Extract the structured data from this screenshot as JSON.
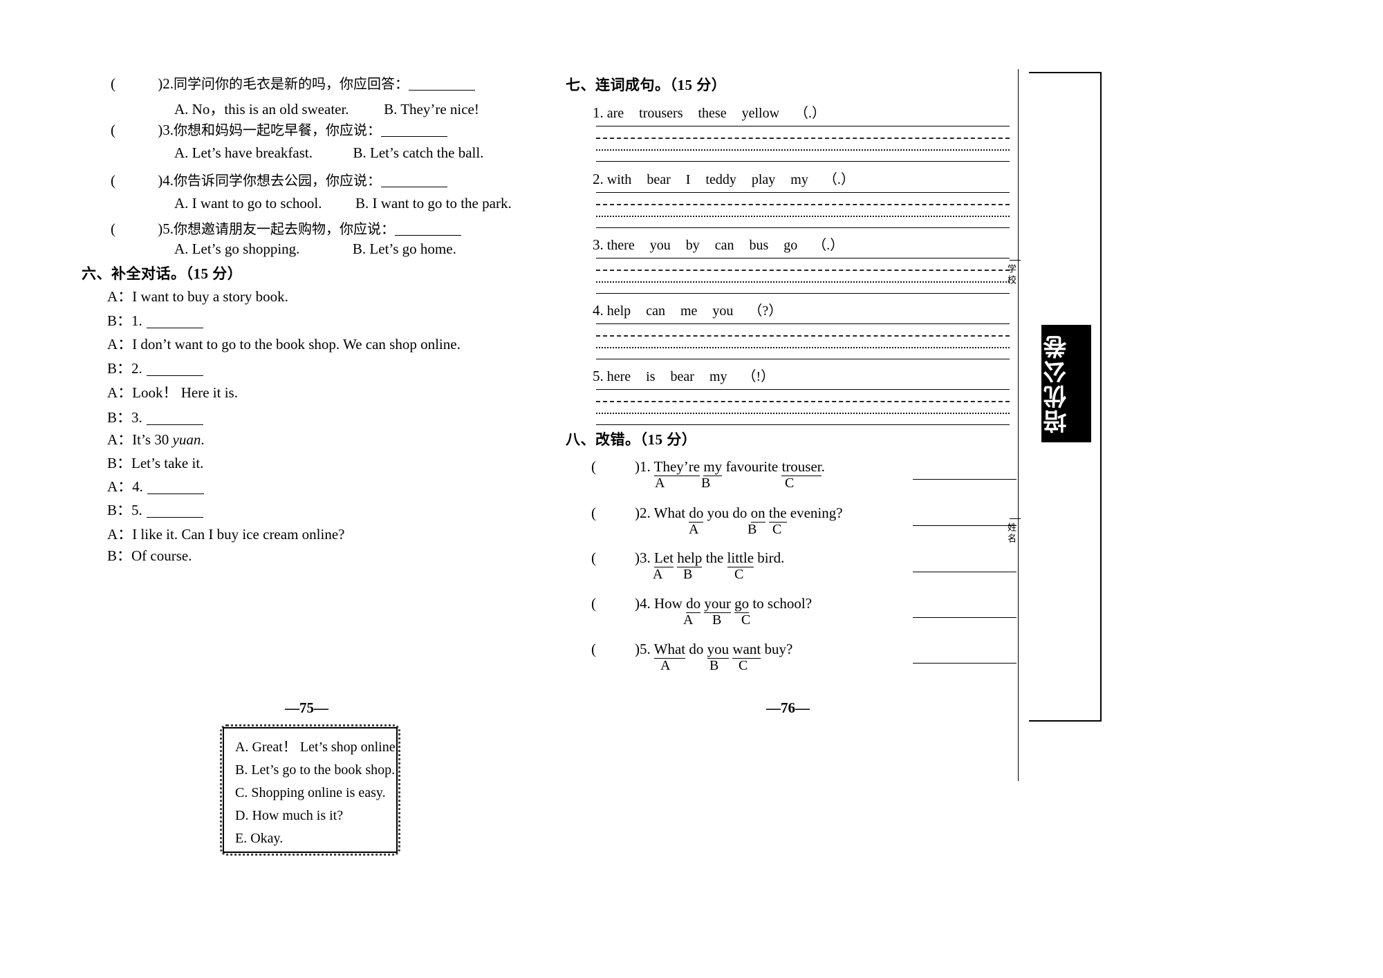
{
  "left_page": {
    "page_number": "—75—",
    "choice_questions": [
      {
        "marker": "(",
        "marker_close": ")",
        "number": "2.",
        "prompt": "同学问你的毛衣是新的吗，你应回答：",
        "option_a": "A. No，this is an old sweater.",
        "option_b": "B. They’re nice!"
      },
      {
        "marker": "(",
        "marker_close": ")",
        "number": "3.",
        "prompt": "你想和妈妈一起吃早餐，你应说：",
        "option_a": "A. Let’s have breakfast.",
        "option_b": "B. Let’s catch the ball."
      },
      {
        "marker": "(",
        "marker_close": ")",
        "number": "4.",
        "prompt": "你告诉同学你想去公园，你应说：",
        "option_a": "A. I want to go to school.",
        "option_b": "B. I want to go to the park."
      },
      {
        "marker": "(",
        "marker_close": ")",
        "number": "5.",
        "prompt": "你想邀请朋友一起去购物，你应说：",
        "option_a": "A. Let’s go shopping.",
        "option_b": "B. Let’s go home."
      }
    ],
    "section_six": {
      "heading": "六、补全对话。",
      "score": "（15 分）",
      "dialogue": [
        {
          "speaker": "A：",
          "text": "I want to buy a story book.",
          "blank": false
        },
        {
          "speaker": "B：",
          "text": "1.",
          "blank": true
        },
        {
          "speaker": "A：",
          "text": "I don’t want to go to the book shop. We can shop online.",
          "blank": false
        },
        {
          "speaker": "B：",
          "text": "2.",
          "blank": true
        },
        {
          "speaker": "A：",
          "text": "Look！ Here it is.",
          "blank": false
        },
        {
          "speaker": "B：",
          "text": "3.",
          "blank": true
        },
        {
          "speaker": "A：",
          "text": "It’s 30 ",
          "italic": "yuan",
          "tail": ".",
          "blank": false
        },
        {
          "speaker": "B：",
          "text": "Let’s take it.",
          "blank": false
        },
        {
          "speaker": "A：",
          "text": "4.",
          "blank": true
        },
        {
          "speaker": "B：",
          "text": "5.",
          "blank": true
        },
        {
          "speaker": "A：",
          "text": "I like it. Can I buy ice cream online?",
          "blank": false
        },
        {
          "speaker": "B：",
          "text": "Of course.",
          "blank": false
        }
      ],
      "choice_box": [
        "A. Great！ Let’s shop online.",
        "B. Let’s go to the book shop.",
        "C. Shopping online is easy.",
        "D. How much is it?",
        "E. Okay."
      ]
    }
  },
  "right_page": {
    "page_number": "—76—",
    "section_seven": {
      "heading": "七、连词成句。",
      "score": "（15 分）",
      "items": [
        {
          "number": "1.",
          "words": [
            "are",
            "trousers",
            "these",
            "yellow",
            "（.）"
          ]
        },
        {
          "number": "2.",
          "words": [
            "with",
            "bear",
            "I",
            "teddy",
            "play",
            "my",
            "（.）"
          ]
        },
        {
          "number": "3.",
          "words": [
            "there",
            "you",
            "by",
            "can",
            "bus",
            "go",
            "（.）"
          ]
        },
        {
          "number": "4.",
          "words": [
            "help",
            "can",
            "me",
            "you",
            "（?）"
          ]
        },
        {
          "number": "5.",
          "words": [
            "here",
            "is",
            "bear",
            "my",
            "（!）"
          ]
        }
      ]
    },
    "section_eight": {
      "heading": "八、改错。",
      "score": "（15 分）",
      "items": [
        {
          "marker": "(",
          "marker_close": ")",
          "number": "1.",
          "parts": [
            {
              "text": "They’re",
              "underlined": true,
              "label": "A"
            },
            {
              "text": "my",
              "underlined": true,
              "label": "B"
            },
            {
              "text": "favourite",
              "underlined": false,
              "label": ""
            },
            {
              "text": "trouser",
              "underlined": true,
              "label": "C"
            },
            {
              "text": ".",
              "underlined": false,
              "label": ""
            }
          ]
        },
        {
          "marker": "(",
          "marker_close": ")",
          "number": "2.",
          "parts": [
            {
              "text": "What",
              "underlined": false,
              "label": ""
            },
            {
              "text": "do",
              "underlined": true,
              "label": "A"
            },
            {
              "text": "you do",
              "underlined": false,
              "label": ""
            },
            {
              "text": "on",
              "underlined": true,
              "label": "B"
            },
            {
              "text": "the",
              "underlined": true,
              "label": "C"
            },
            {
              "text": "evening?",
              "underlined": false,
              "label": ""
            }
          ]
        },
        {
          "marker": "(",
          "marker_close": ")",
          "number": "3.",
          "parts": [
            {
              "text": "Let",
              "underlined": true,
              "label": "A"
            },
            {
              "text": "help",
              "underlined": true,
              "label": "B"
            },
            {
              "text": "the",
              "underlined": false,
              "label": ""
            },
            {
              "text": "little",
              "underlined": true,
              "label": "C"
            },
            {
              "text": "bird.",
              "underlined": false,
              "label": ""
            }
          ]
        },
        {
          "marker": "(",
          "marker_close": ")",
          "number": "4.",
          "parts": [
            {
              "text": "How",
              "underlined": false,
              "label": ""
            },
            {
              "text": "do",
              "underlined": true,
              "label": "A"
            },
            {
              "text": "your",
              "underlined": true,
              "label": "B"
            },
            {
              "text": "go",
              "underlined": true,
              "label": "C"
            },
            {
              "text": "to school?",
              "underlined": false,
              "label": ""
            }
          ]
        },
        {
          "marker": "(",
          "marker_close": ")",
          "number": "5.",
          "parts": [
            {
              "text": "What",
              "underlined": true,
              "label": "A"
            },
            {
              "text": "do",
              "underlined": false,
              "label": ""
            },
            {
              "text": "you",
              "underlined": true,
              "label": "B"
            },
            {
              "text": "want",
              "underlined": true,
              "label": "C"
            },
            {
              "text": "buy?",
              "underlined": false,
              "label": ""
            }
          ]
        }
      ]
    },
    "binding": {
      "seal_text": "培优公卷",
      "label_top": "学校",
      "label_bottom": "姓名"
    }
  }
}
